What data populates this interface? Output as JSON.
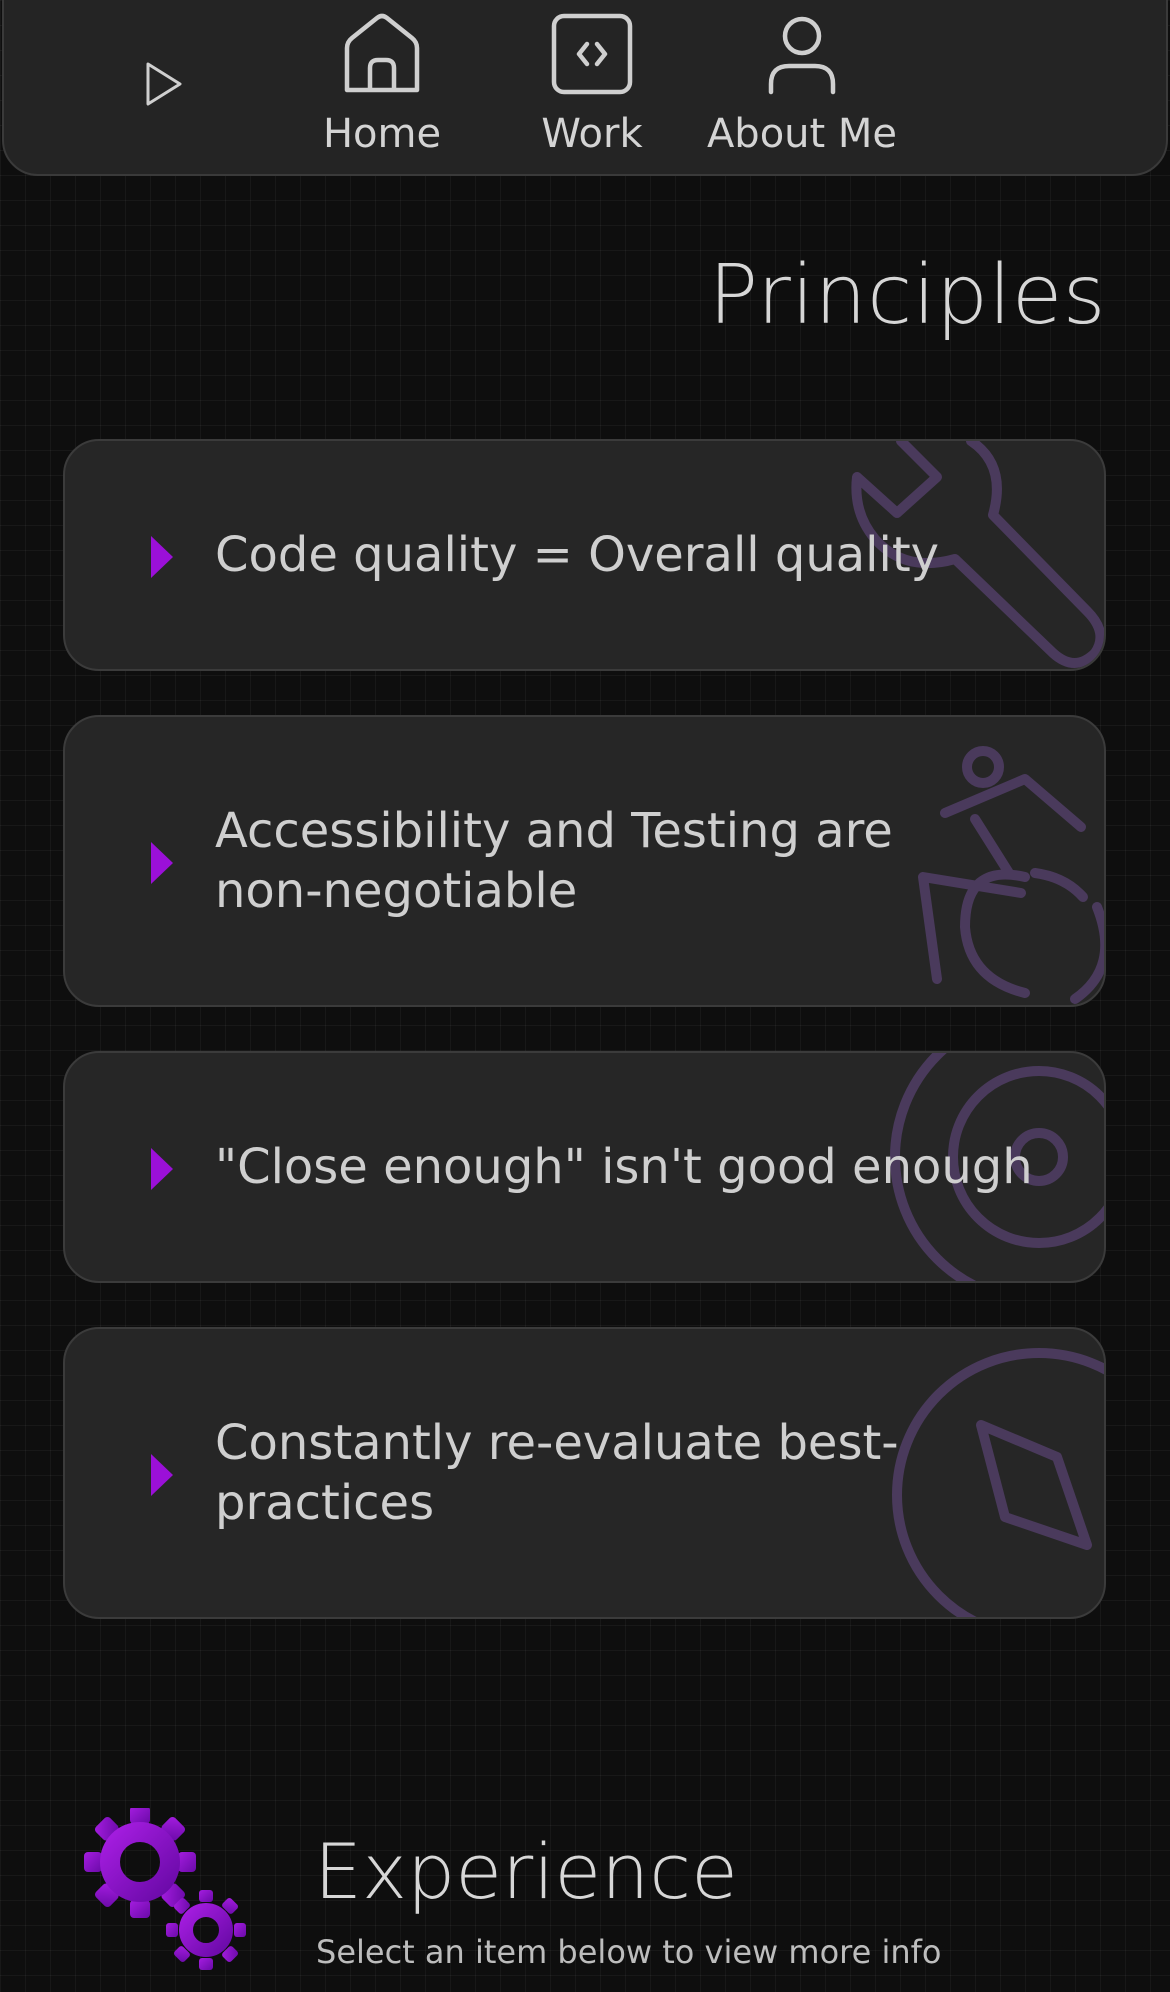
{
  "nav": {
    "toggle_icon": "play-triangle-icon",
    "items": [
      {
        "label": "Home",
        "icon": "home-icon"
      },
      {
        "label": "Work",
        "icon": "code-icon"
      },
      {
        "label": "About Me",
        "icon": "user-icon"
      }
    ]
  },
  "principles": {
    "title": "Principles",
    "items": [
      {
        "text": "Code quality = Overall quality",
        "icon": "wrench-icon"
      },
      {
        "text": "Accessibility and Testing are non-negotiable",
        "icon": "wheelchair-icon"
      },
      {
        "text": "\"Close enough\" isn't good enough",
        "icon": "target-icon"
      },
      {
        "text": "Constantly re-evaluate best-practices",
        "icon": "compass-icon"
      }
    ]
  },
  "experience": {
    "title": "Experience",
    "subtitle": "Select an item below to view more info",
    "icon": "gears-icon"
  },
  "colors": {
    "background": "#0e0e0e",
    "surface": "#262626",
    "accent": "#9b10d8",
    "decoration": "#4a3a5c",
    "text": "#cfcfcf"
  }
}
